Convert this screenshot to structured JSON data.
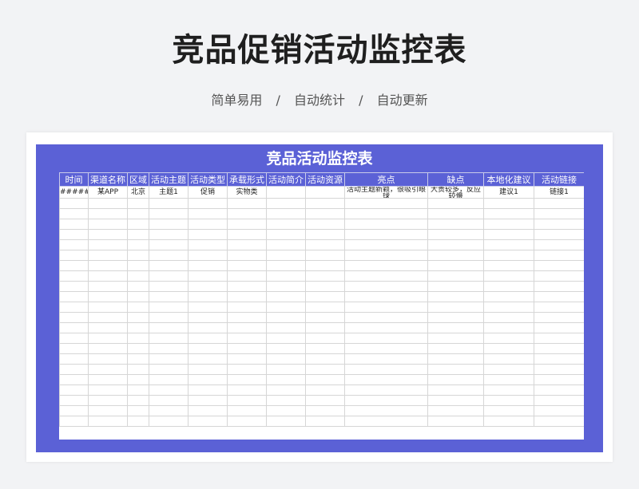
{
  "page": {
    "title": "竞品促销活动监控表",
    "subtitle_items": [
      "简单易用",
      "自动统计",
      "自动更新"
    ],
    "separator": "/"
  },
  "sheet": {
    "title": "竞品活动监控表",
    "accent_color": "#5b61d6",
    "columns": [
      "时间",
      "渠道名称",
      "区域",
      "活动主题",
      "活动类型",
      "承载形式",
      "活动简介",
      "活动资源",
      "亮点",
      "缺点",
      "本地化建议",
      "活动链接"
    ],
    "rows": [
      [
        "######",
        "某APP",
        "北京",
        "主题1",
        "促销",
        "实物类",
        "",
        "",
        "活动主题新颖，很吸引眼球",
        "大贵较多，反应较慢",
        "建议1",
        "链接1"
      ]
    ]
  }
}
